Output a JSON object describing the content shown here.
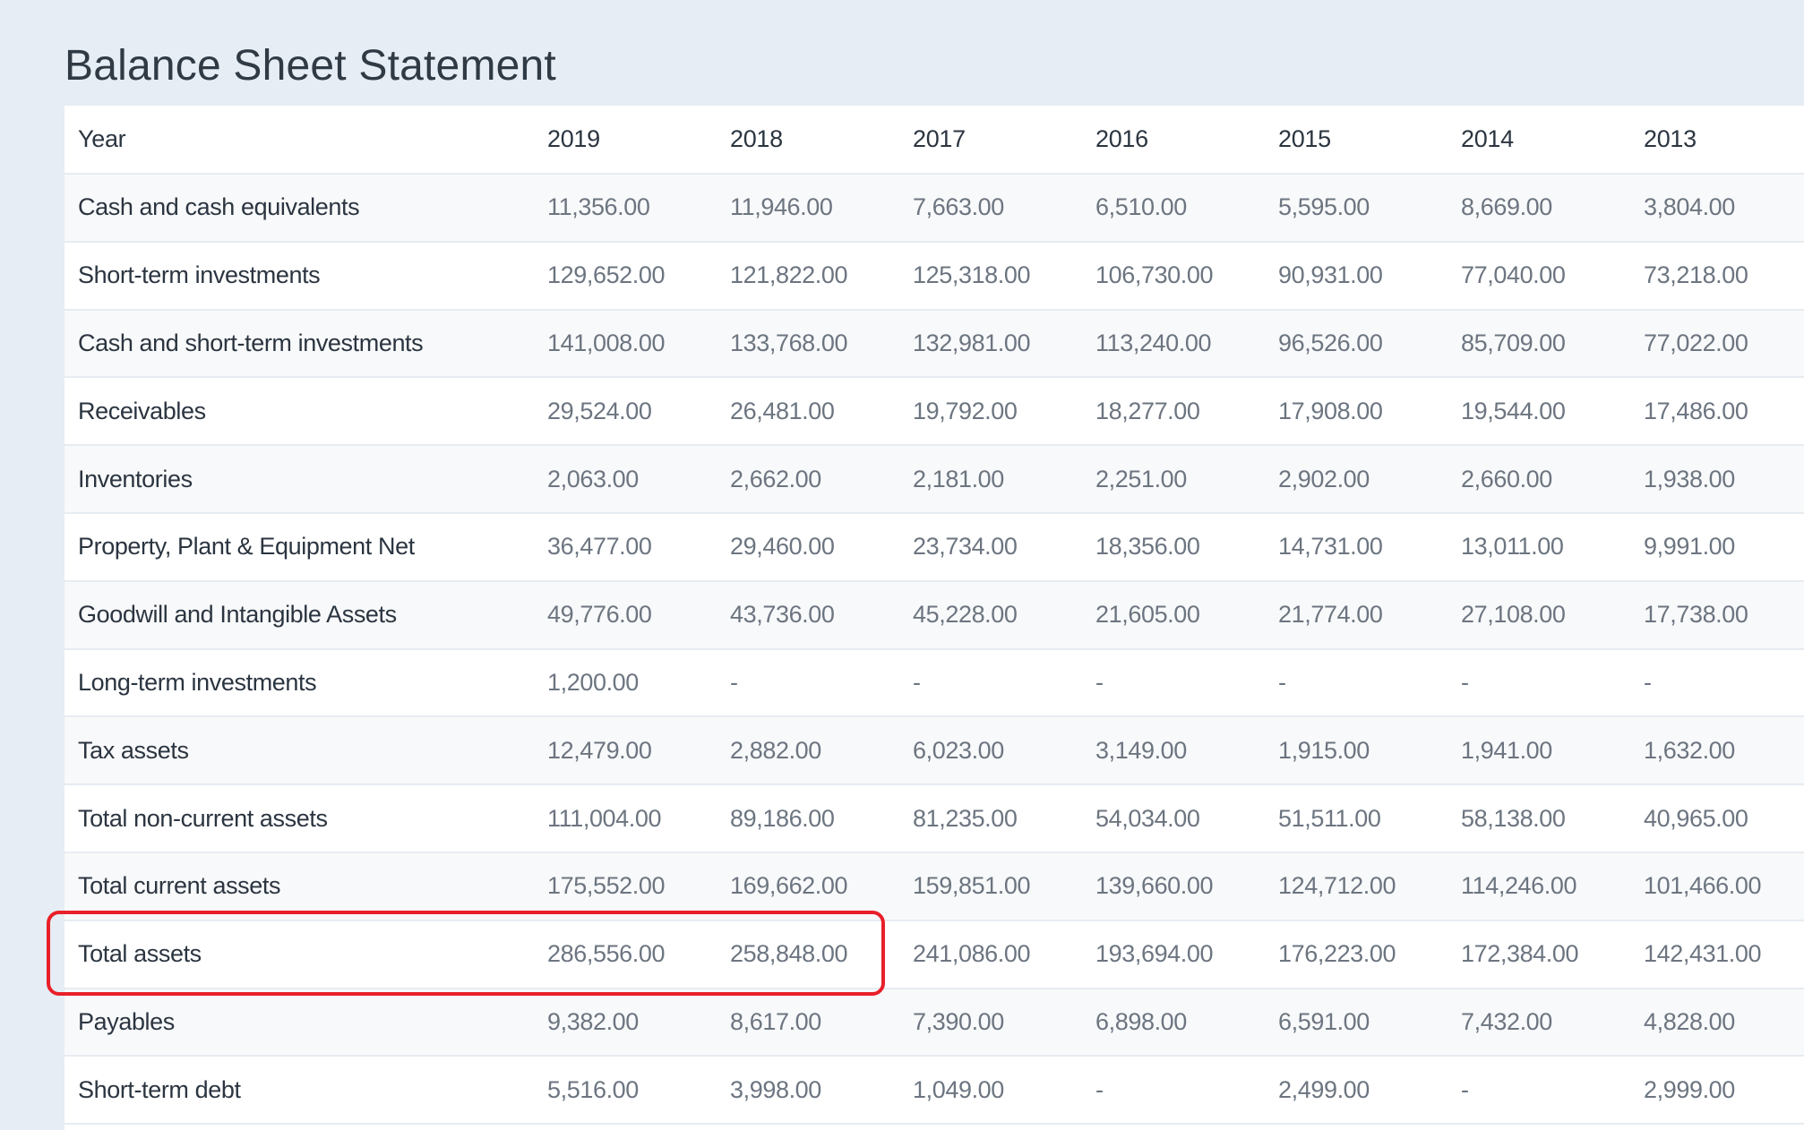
{
  "title": "Balance Sheet Statement",
  "highlight_color": "#e8202a",
  "table": {
    "header_label": "Year",
    "years": [
      "2019",
      "2018",
      "2017",
      "2016",
      "2015",
      "2014",
      "2013"
    ],
    "rows": [
      {
        "label": "Cash and cash equivalents",
        "values": [
          "11,356.00",
          "11,946.00",
          "7,663.00",
          "6,510.00",
          "5,595.00",
          "8,669.00",
          "3,804.00"
        ]
      },
      {
        "label": "Short-term investments",
        "values": [
          "129,652.00",
          "121,822.00",
          "125,318.00",
          "106,730.00",
          "90,931.00",
          "77,040.00",
          "73,218.00"
        ]
      },
      {
        "label": "Cash and short-term investments",
        "values": [
          "141,008.00",
          "133,768.00",
          "132,981.00",
          "113,240.00",
          "96,526.00",
          "85,709.00",
          "77,022.00"
        ]
      },
      {
        "label": "Receivables",
        "values": [
          "29,524.00",
          "26,481.00",
          "19,792.00",
          "18,277.00",
          "17,908.00",
          "19,544.00",
          "17,486.00"
        ]
      },
      {
        "label": "Inventories",
        "values": [
          "2,063.00",
          "2,662.00",
          "2,181.00",
          "2,251.00",
          "2,902.00",
          "2,660.00",
          "1,938.00"
        ]
      },
      {
        "label": "Property, Plant & Equipment Net",
        "values": [
          "36,477.00",
          "29,460.00",
          "23,734.00",
          "18,356.00",
          "14,731.00",
          "13,011.00",
          "9,991.00"
        ]
      },
      {
        "label": "Goodwill and Intangible Assets",
        "values": [
          "49,776.00",
          "43,736.00",
          "45,228.00",
          "21,605.00",
          "21,774.00",
          "27,108.00",
          "17,738.00"
        ]
      },
      {
        "label": "Long-term investments",
        "values": [
          "1,200.00",
          "-",
          "-",
          "-",
          "-",
          "-",
          "-"
        ]
      },
      {
        "label": "Tax assets",
        "values": [
          "12,479.00",
          "2,882.00",
          "6,023.00",
          "3,149.00",
          "1,915.00",
          "1,941.00",
          "1,632.00"
        ]
      },
      {
        "label": "Total non-current assets",
        "values": [
          "111,004.00",
          "89,186.00",
          "81,235.00",
          "54,034.00",
          "51,511.00",
          "58,138.00",
          "40,965.00"
        ]
      },
      {
        "label": "Total current assets",
        "values": [
          "175,552.00",
          "169,662.00",
          "159,851.00",
          "139,660.00",
          "124,712.00",
          "114,246.00",
          "101,466.00"
        ]
      },
      {
        "label": "Total assets",
        "values": [
          "286,556.00",
          "258,848.00",
          "241,086.00",
          "193,694.00",
          "176,223.00",
          "172,384.00",
          "142,431.00"
        ]
      },
      {
        "label": "Payables",
        "values": [
          "9,382.00",
          "8,617.00",
          "7,390.00",
          "6,898.00",
          "6,591.00",
          "7,432.00",
          "4,828.00"
        ]
      },
      {
        "label": "Short-term debt",
        "values": [
          "5,516.00",
          "3,998.00",
          "1,049.00",
          "-",
          "2,499.00",
          "-",
          "2,999.00"
        ]
      }
    ]
  }
}
